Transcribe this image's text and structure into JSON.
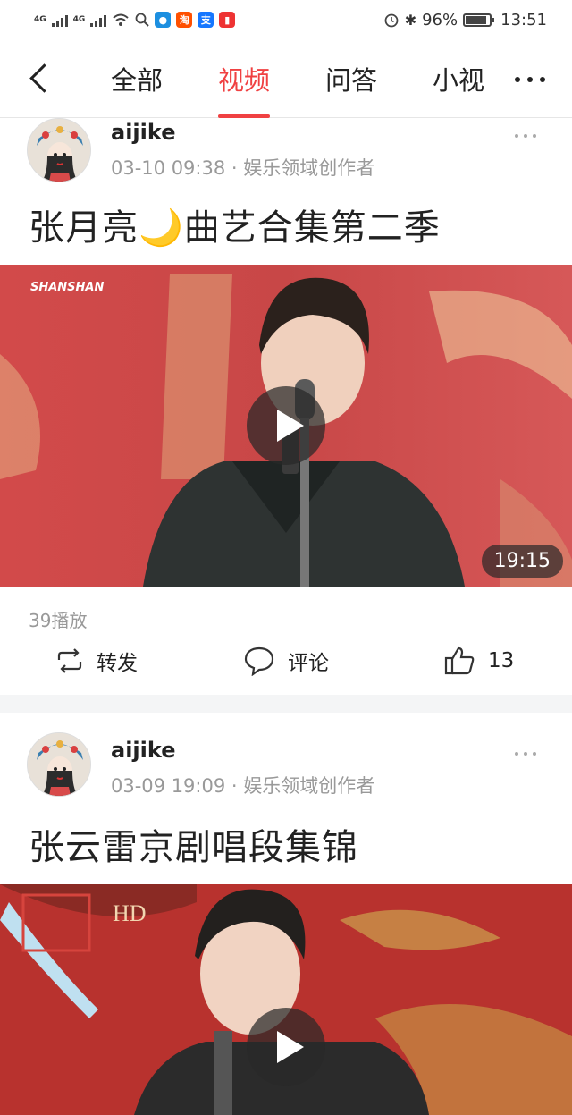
{
  "status_bar": {
    "network_left": "4G",
    "network_right": "4G",
    "battery": "96%",
    "time": "13:51",
    "apps": [
      "淘",
      "支"
    ]
  },
  "nav": {
    "tabs": [
      "全部",
      "视频",
      "问答",
      "小视"
    ],
    "active_tab": "视频"
  },
  "posts": [
    {
      "user": "aijike",
      "date": "03-10 09:38",
      "role": "娱乐领域创作者",
      "title": "张月亮🌙曲艺合集第二季",
      "watermark": "SHANSHAN",
      "duration": "19:15",
      "plays": "39播放",
      "share": "转发",
      "comment": "评论",
      "likes": "13"
    },
    {
      "user": "aijike",
      "date": "03-09 19:09",
      "role": "娱乐领域创作者",
      "title": "张云雷京剧唱段集锦",
      "watermark": "HD"
    }
  ],
  "separator": " · ",
  "colors": {
    "accent": "#f04142"
  }
}
